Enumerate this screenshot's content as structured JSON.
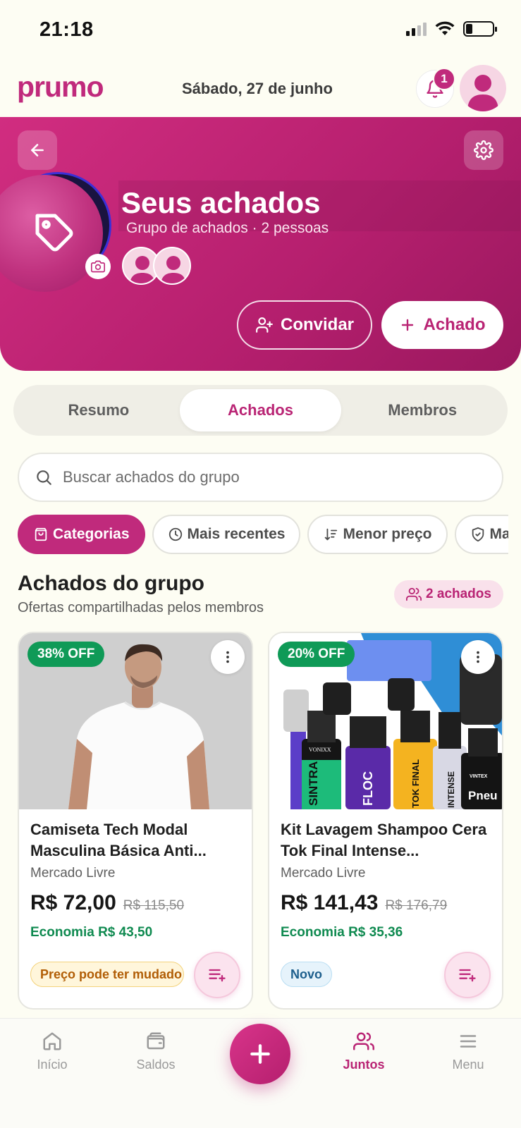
{
  "status_bar": {
    "time": "21:18"
  },
  "header": {
    "logo": "prumo",
    "date": "Sábado, 27 de junho",
    "notification_count": "1"
  },
  "group": {
    "title": "Seus achados",
    "subtitle": "Grupo de achados · 2 pessoas",
    "invite_label": "Convidar",
    "add_label": "Achado"
  },
  "tabs": [
    {
      "label": "Resumo",
      "active": false
    },
    {
      "label": "Achados",
      "active": true
    },
    {
      "label": "Membros",
      "active": false
    }
  ],
  "search": {
    "placeholder": "Buscar achados do grupo"
  },
  "filters": [
    {
      "label": "Categorias",
      "icon": "bag-icon",
      "active": true
    },
    {
      "label": "Mais recentes",
      "icon": "clock-icon",
      "active": false
    },
    {
      "label": "Menor preço",
      "icon": "sort-icon",
      "active": false
    },
    {
      "label": "Ma",
      "icon": "shield-icon",
      "active": false
    }
  ],
  "section": {
    "title": "Achados do grupo",
    "subtitle": "Ofertas compartilhadas pelos membros",
    "count_label": "2 achados"
  },
  "products": [
    {
      "discount": "38% OFF",
      "title": "Camiseta Tech Modal Masculina Básica Anti...",
      "store": "Mercado Livre",
      "price": "R$ 72,00",
      "old_price": "R$ 115,50",
      "savings": "Economia R$ 43,50",
      "tag": "Preço pode ter mudado",
      "tag_type": "warning"
    },
    {
      "discount": "20% OFF",
      "title": "Kit Lavagem Shampoo Cera Tok Final Intense...",
      "store": "Mercado Livre",
      "price": "R$ 141,43",
      "old_price": "R$ 176,79",
      "savings": "Economia R$ 35,36",
      "tag": "Novo",
      "tag_type": "info",
      "bottle_labels": [
        "SINTRA",
        "FLOC",
        "TOK FINAL",
        "INTENSE",
        "Pneu"
      ],
      "brand_labels": [
        "VONIXX",
        "VINTEX"
      ]
    }
  ],
  "bottom_nav": [
    {
      "label": "Início",
      "icon": "home-icon",
      "active": false
    },
    {
      "label": "Saldos",
      "icon": "wallet-icon",
      "active": false
    },
    {
      "label": "Juntos",
      "icon": "users-icon",
      "active": true
    },
    {
      "label": "Menu",
      "icon": "menu-icon",
      "active": false
    }
  ],
  "colors": {
    "brand": "#c02a7c",
    "success": "#0f9a57",
    "background": "#fdfdf3"
  }
}
